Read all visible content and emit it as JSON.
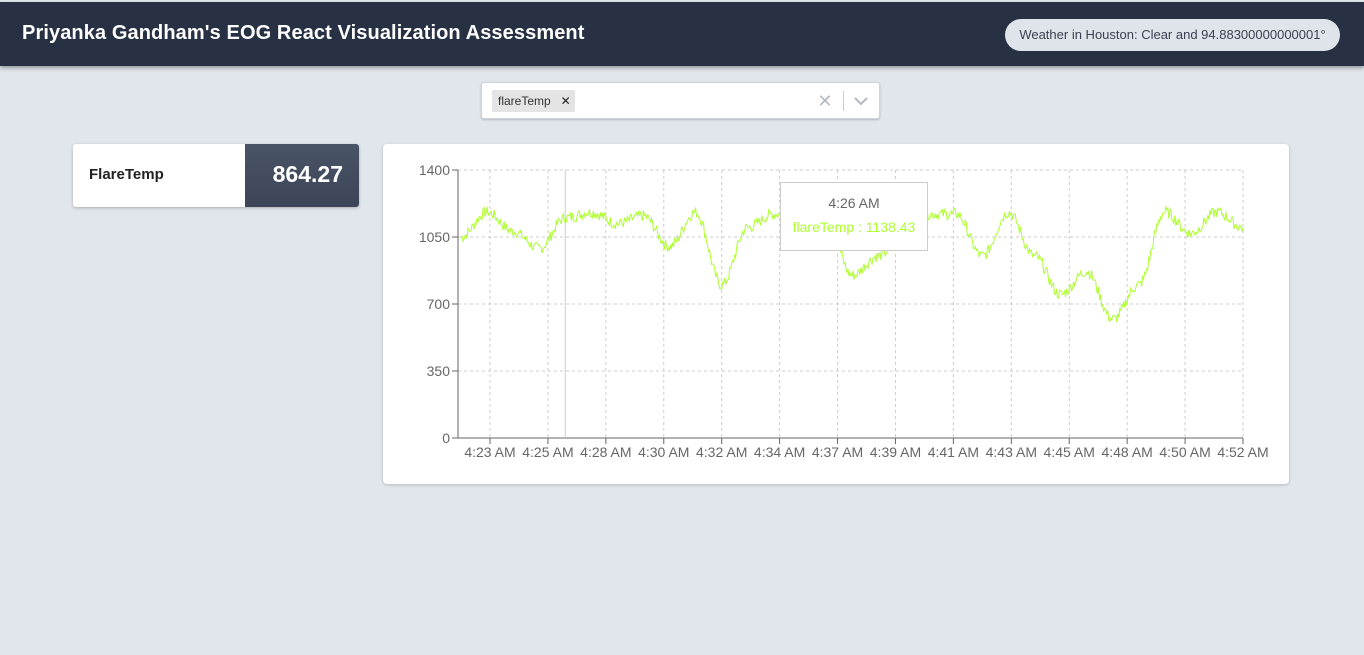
{
  "header": {
    "title": "Priyanka Gandham's EOG React Visualization Assessment",
    "weather": "Weather in Houston: Clear and 94.88300000000001°"
  },
  "selector": {
    "selected": [
      {
        "label": "flareTemp",
        "remove_icon": "close-icon"
      }
    ],
    "clear_icon": "close-icon",
    "dropdown_icon": "chevron-down-icon"
  },
  "metric_card": {
    "name": "FlareTemp",
    "value": "864.27"
  },
  "tooltip": {
    "time": "4:26 AM",
    "series": "flareTemp",
    "value": "1138.43",
    "text": "flareTemp : 1138.43"
  },
  "colors": {
    "header_bg": "#283143",
    "page_bg": "#e1e6ed",
    "line": "#adff2f",
    "metric_value_bg": "#444d60"
  },
  "chart_data": {
    "type": "line",
    "ylim": [
      0,
      1400
    ],
    "y_ticks": [
      0,
      350,
      700,
      1050,
      1400
    ],
    "x_ticks": [
      "4:23 AM",
      "4:25 AM",
      "4:28 AM",
      "4:30 AM",
      "4:32 AM",
      "4:34 AM",
      "4:37 AM",
      "4:39 AM",
      "4:41 AM",
      "4:43 AM",
      "4:45 AM",
      "4:48 AM",
      "4:50 AM",
      "4:52 AM"
    ],
    "grid": true,
    "series": [
      {
        "name": "flareTemp",
        "color": "#adff2f",
        "x": [
          "4:22 AM",
          "4:23 AM",
          "4:24 AM",
          "4:25 AM",
          "4:26 AM",
          "4:27 AM",
          "4:28 AM",
          "4:29 AM",
          "4:30 AM",
          "4:31 AM",
          "4:32 AM",
          "4:33 AM",
          "4:34 AM",
          "4:35 AM",
          "4:36 AM",
          "4:37 AM",
          "4:38 AM",
          "4:39 AM",
          "4:40 AM",
          "4:41 AM",
          "4:42 AM",
          "4:43 AM",
          "4:44 AM",
          "4:45 AM",
          "4:46 AM",
          "4:47 AM",
          "4:48 AM",
          "4:49 AM",
          "4:50 AM",
          "4:51 AM",
          "4:52 AM"
        ],
        "values": [
          1050,
          1180,
          1080,
          990,
          1150,
          1180,
          1120,
          1160,
          1000,
          1180,
          800,
          1100,
          1170,
          1180,
          1160,
          850,
          950,
          1050,
          1170,
          1170,
          950,
          1180,
          950,
          750,
          870,
          620,
          800,
          1180,
          1070,
          1180,
          1100
        ]
      }
    ]
  }
}
